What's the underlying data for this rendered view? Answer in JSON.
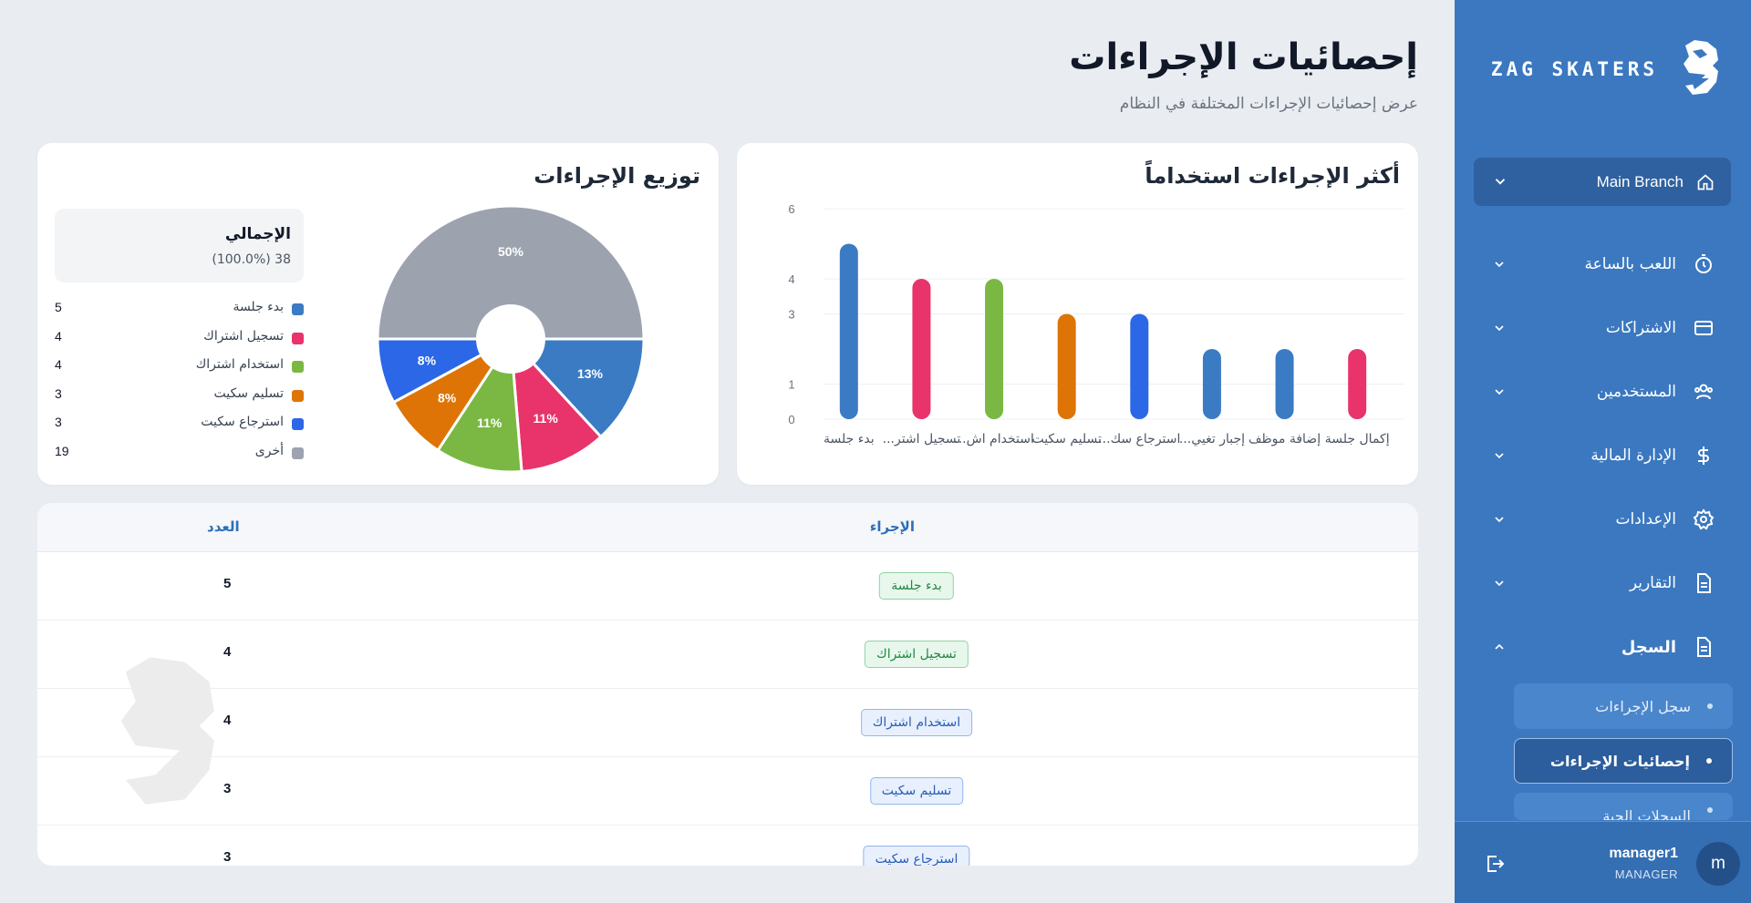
{
  "brand": {
    "name": "ZAG SKATERS"
  },
  "sidebar": {
    "branch": "Main Branch",
    "items": [
      {
        "label": "اللعب بالساعة",
        "icon": "stopwatch-icon"
      },
      {
        "label": "الاشتراكات",
        "icon": "credit-card-icon"
      },
      {
        "label": "المستخدمين",
        "icon": "users-icon"
      },
      {
        "label": "الإدارة المالية",
        "icon": "dollar-icon"
      },
      {
        "label": "الإعدادات",
        "icon": "gear-icon"
      },
      {
        "label": "التقارير",
        "icon": "document-icon"
      },
      {
        "label": "السجل",
        "icon": "document-icon"
      }
    ],
    "sub_items": [
      {
        "label": "سجل الإجراءات"
      },
      {
        "label": "إحصائيات الإجراءات"
      },
      {
        "label": "السجلات الحية"
      }
    ]
  },
  "user": {
    "initial": "m",
    "name": "manager1",
    "role": "MANAGER"
  },
  "header": {
    "title": "إحصائيات الإجراءات",
    "subtitle": "عرض إحصائيات الإجراءات المختلفة في النظام"
  },
  "bar_card": {
    "title": "أكثر الإجراءات استخداماً"
  },
  "pie_card": {
    "title": "توزيع الإجراءات",
    "total_label": "الإجمالي",
    "total_value": "38 (100.0%)"
  },
  "chart_data": [
    {
      "type": "bar",
      "title": "أكثر الإجراءات استخداماً",
      "categories": [
        "بدء جلسة",
        "تسجيل اشتر...",
        "استخدام اش...",
        "تسليم سكيت",
        "استرجاع سك...",
        "إجبار تغيي...",
        "إضافة موظف",
        "إكمال جلسة"
      ],
      "values": [
        5,
        4,
        4,
        3,
        3,
        2,
        2,
        2
      ],
      "colors": [
        "#3b7bc4",
        "#e8336b",
        "#7ab843",
        "#de7406",
        "#2b67e6",
        "#3b7bc4",
        "#3b7bc4",
        "#e8336b"
      ],
      "yticks": [
        0,
        1,
        3,
        4,
        6
      ],
      "ylim": [
        0,
        6
      ],
      "grid": true
    },
    {
      "type": "pie",
      "title": "توزيع الإجراءات",
      "labels": [
        "بدء جلسة",
        "تسجيل اشتراك",
        "استخدام اشتراك",
        "تسليم سكيت",
        "استرجاع سكيت",
        "أخرى"
      ],
      "values": [
        5,
        4,
        4,
        3,
        3,
        19
      ],
      "percent_labels": [
        "13%",
        "11%",
        "11%",
        "8%",
        "8%",
        "50%"
      ],
      "colors": [
        "#3b7bc4",
        "#e8336b",
        "#7ab843",
        "#de7406",
        "#2b67e6",
        "#9ca3af"
      ],
      "donut": true
    }
  ],
  "table": {
    "headers": {
      "action": "الإجراء",
      "count": "العدد"
    },
    "rows": [
      {
        "action": "بدء جلسة",
        "count": "5",
        "style": "green"
      },
      {
        "action": "تسجيل اشتراك",
        "count": "4",
        "style": "green"
      },
      {
        "action": "استخدام اشتراك",
        "count": "4",
        "style": "blue"
      },
      {
        "action": "تسليم سكيت",
        "count": "3",
        "style": "blue"
      },
      {
        "action": "استرجاع سكيت",
        "count": "3",
        "style": "blue"
      }
    ]
  }
}
